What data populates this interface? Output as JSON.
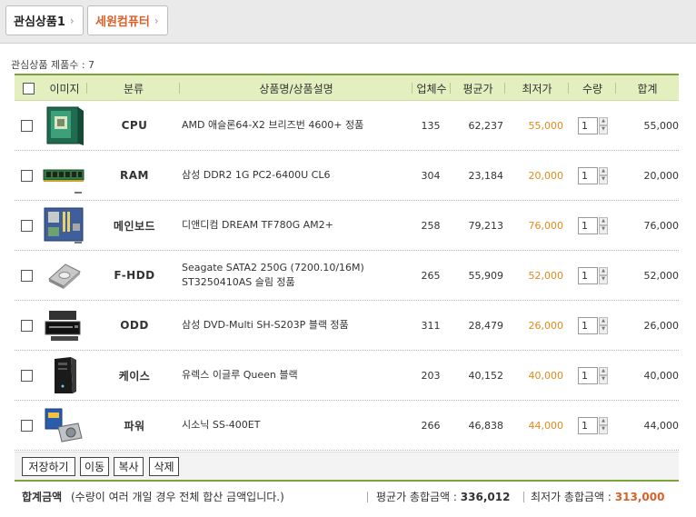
{
  "tabs": [
    {
      "label": "관심상품1",
      "arrow": "›"
    },
    {
      "label": "세원컴퓨터",
      "arrow": "›"
    }
  ],
  "product_count": "관심상품 제품수 : 7",
  "headers": {
    "image": "이미지",
    "category": "분류",
    "name": "상품명/상품설명",
    "vendors": "업체수",
    "avg_price": "평균가",
    "low_price": "최저가",
    "qty": "수량",
    "total": "합계"
  },
  "rows": [
    {
      "category": "CPU",
      "name": "AMD 애슬론64-X2 브리즈번 4600+ 정품",
      "vendors": "135",
      "avg": "62,237",
      "low": "55,000",
      "qty": "1",
      "total": "55,000",
      "icon": "cpu-box-icon"
    },
    {
      "category": "RAM",
      "name": "삼성 DDR2 1G PC2-6400U CL6",
      "vendors": "304",
      "avg": "23,184",
      "low": "20,000",
      "qty": "1",
      "total": "20,000",
      "icon": "ram-stick-icon"
    },
    {
      "category": "메인보드",
      "name": "디앤디컴 DREAM TF780G AM2+",
      "vendors": "258",
      "avg": "79,213",
      "low": "76,000",
      "qty": "1",
      "total": "76,000",
      "icon": "motherboard-icon"
    },
    {
      "category": "F-HDD",
      "name": "Seagate SATA2 250G (7200.10/16M) ST3250410AS 슬림 정품",
      "vendors": "265",
      "avg": "55,909",
      "low": "52,000",
      "qty": "1",
      "total": "52,000",
      "icon": "hard-drive-icon"
    },
    {
      "category": "ODD",
      "name": "삼성 DVD-Multi SH-S203P 블랙 정품",
      "vendors": "311",
      "avg": "28,479",
      "low": "26,000",
      "qty": "1",
      "total": "26,000",
      "icon": "dvd-drive-icon"
    },
    {
      "category": "케이스",
      "name": "유렉스 이글루 Queen 블랙",
      "vendors": "203",
      "avg": "40,152",
      "low": "40,000",
      "qty": "1",
      "total": "40,000",
      "icon": "pc-case-icon"
    },
    {
      "category": "파워",
      "name": "시소닉 SS-400ET",
      "vendors": "266",
      "avg": "46,838",
      "low": "44,000",
      "qty": "1",
      "total": "44,000",
      "icon": "power-supply-icon"
    }
  ],
  "buttons": {
    "save": "저장하기",
    "move": "이동",
    "copy": "복사",
    "delete": "삭제"
  },
  "summary": {
    "label": "합계금액",
    "note": "(수량이 여러 개일 경우 전체 합산 금액입니다.)",
    "avg_label": "평균가 총합금액 : ",
    "avg_value": "336,012",
    "low_label": "최저가 총합금액 : ",
    "low_value": "313,000"
  },
  "colors": {
    "accent_green": "#7ea33b",
    "header_bg": "#e4efbf",
    "price_orange": "#e08a1a",
    "tab_orange": "#d9602a"
  }
}
